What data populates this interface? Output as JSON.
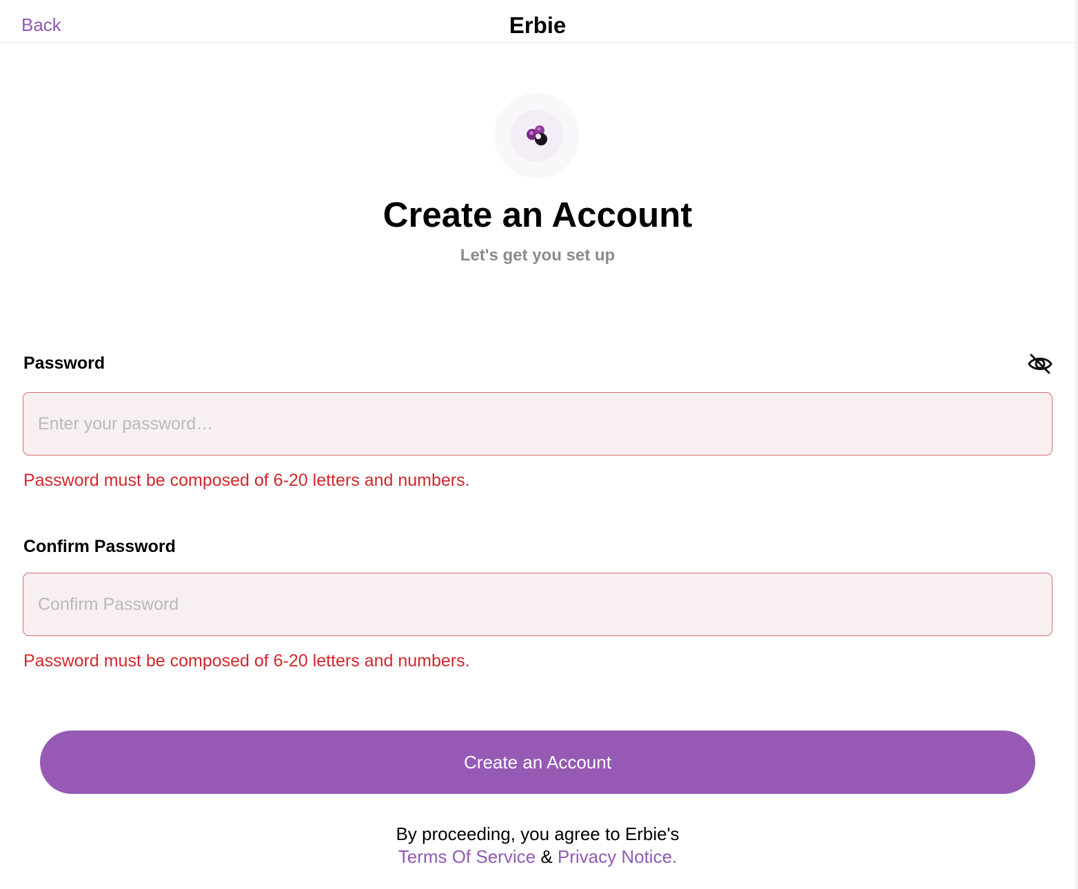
{
  "header": {
    "back_label": "Back",
    "app_title": "Erbie"
  },
  "logo": {
    "icon": "erbie-logo-icon"
  },
  "main": {
    "title": "Create an Account",
    "subtitle": "Let's get you set up"
  },
  "form": {
    "password": {
      "label": "Password",
      "placeholder": "Enter your password…",
      "value": "",
      "visibility_icon": "eye-slash-icon",
      "error": "Password must be composed of 6-20 letters and numbers."
    },
    "confirm_password": {
      "label": "Confirm Password",
      "placeholder": "Confirm Password",
      "value": "",
      "error": "Password must be composed of 6-20 letters and numbers."
    },
    "submit_label": "Create an Account"
  },
  "legal": {
    "intro": "By proceeding, you agree to Erbie's",
    "terms_label": "Terms Of Service",
    "separator": "&",
    "privacy_label": "Privacy Notice."
  },
  "colors": {
    "accent": "#965ab4",
    "link": "#9159b6",
    "error": "#d2262c",
    "input_error_border": "#d96a6f",
    "input_error_background": "#f8eff1"
  }
}
